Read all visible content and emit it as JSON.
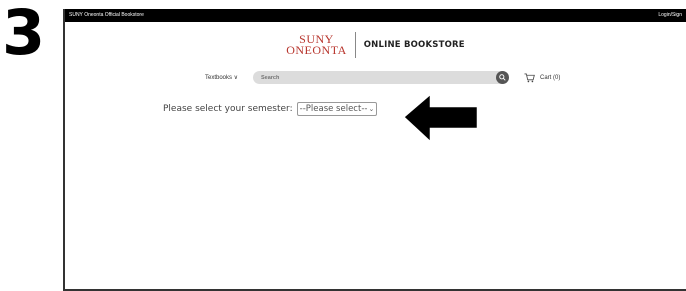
{
  "step_number": "3",
  "top_bar": {
    "left_text": "SUNY Oneonta Official Bookstore",
    "right_text": "Login/Sign"
  },
  "logo": {
    "line1": "SUNY",
    "line2": "ONEONTA",
    "store_name": "ONLINE BOOKSTORE"
  },
  "nav": {
    "textbooks_label": "Textbooks ∨",
    "search_placeholder": "Search",
    "cart_label": "Cart (0)"
  },
  "semester": {
    "prompt": "Please select your semester:",
    "selected": "--Please select--"
  },
  "colors": {
    "brand_red": "#b8362e",
    "top_bar": "#000000",
    "search_bg": "#dcdcdc",
    "search_button": "#555555",
    "arrow": "#000000"
  },
  "icons": {
    "search": "magnifier-icon",
    "cart": "cart-icon",
    "select_chevron": "chevron-down-icon",
    "pointer": "arrow-left-icon"
  }
}
